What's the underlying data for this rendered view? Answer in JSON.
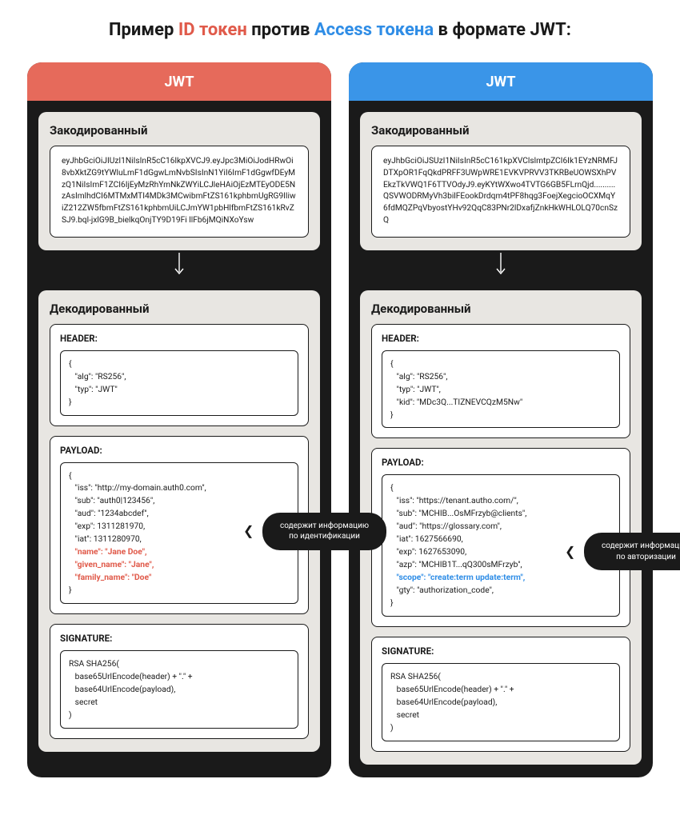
{
  "title": {
    "t1": "Пример ",
    "red": "ID токен",
    "t2": " против ",
    "blue": "Access токена",
    "t3": " в формате JWT:"
  },
  "left": {
    "badge": "JWT",
    "encoded_label": "Закодированный",
    "encoded": "eyJhbGciOiJIUzI1NiIsInR5cC16lkpXVCJ9.eyJpc3MiOiJodHRwOi8vbXktZG9tYWluLmF1dGgwLmNvbSIsInN1YiI6ImF1dGgwfDEyMzQ1NiIsImF1ZCI6IjEyMzRhYmNkZWYiLCJleHAiOjEzMTEyODE5NzAsImlhdCI6MTMxMTI4MDk3MCwibmFtZS161kphbmUgRG9lIiwiZ212ZW5fbmFtZS161kphbmUiLCJmYW1pbHlfbmFtZS161kRvZSJ9.bql-jxlG9B_bielkqOnjTY9D19Fi llFb6jMQiNXoYsw",
    "decoded_label": "Декодированный",
    "header_label": "HEADER:",
    "header_code": "{\n   \"alg\": \"RS256\",\n   \"typ\": \"JWT\"\n}",
    "payload_label": "PAYLOAD:",
    "payload_pre": "{\n   \"iss\": \"http://my-domain.auth0.com\",\n   \"sub\": \"auth0|123456\",\n   \"aud\": \"1234abcdef\",\n   \"exp\": 1311281970,\n   \"iat\": 1311280970,\n",
    "payload_hl1": "   \"name\": \"Jane Doe\",",
    "payload_hl2": "   \"given_name\": \"Jane\",",
    "payload_hl3": "   \"family_name\": \"Doe\"",
    "payload_post": "\n}",
    "callout": "содержит информацию по идентификации",
    "signature_label": "SIGNATURE:",
    "signature_code": "RSA SHA256(\n   base65UrlEncode(header) + \".\" +\n   base64UrlEncode(payload),\n   secret\n)"
  },
  "right": {
    "badge": "JWT",
    "encoded_label": "Закодированный",
    "encoded": "eyJhbGciOiJSUzI1NiIsInR5cC161kpXVClslmtpZCI6Ik1EYzNRMFJDTXpOR1FqQkdPRFF3UWpWRE1EVKVPRVV3TKRBeUOWSXhPVEkzTkVWQ1F6TTVOdyJ9.eyKYtWXwo4TVTG6GB5FLrnQjd..........QSVWODRMyVh3bilFEookDrdqm4tPF8hqg3FoejXegcioOCXMqY6fdMQZPqVbyostYHv92QqC83PNr2lDxafjZnkHkWHLOLQ70cnSzQ",
    "decoded_label": "Декодированный",
    "header_label": "HEADER:",
    "header_code": "{\n   \"alg\": \"RS256\",\n   \"typ\": \"JWT\",\n   \"kid\": \"MDc3Q...TIZNEVCQzM5Nw\"\n}",
    "payload_label": "PAYLOAD:",
    "payload_pre": "{\n   \"iss\": \"https://tenant.autho.com/\",\n   \"sub\": \"MCHIB...OsMFrzyb@clients\",\n   \"aud\": \"https://glossary.com\",\n   \"iat\": 1627566690,\n   \"exp\": 1627653090,\n   \"azp\": \"MCHIB1T...qQ300sMFrzyb\",\n",
    "payload_hl1": "   \"scope\": \"create:term update:term\",",
    "payload_post": "\n   \"gty\": \"authorization_code\",\n}",
    "callout": "содержит информацию по авторизации",
    "signature_label": "SIGNATURE:",
    "signature_code": "RSA SHA256(\n   base65UrlEncode(header) + \".\" +\n   base64UrlEncode(payload),\n   secret\n)"
  }
}
